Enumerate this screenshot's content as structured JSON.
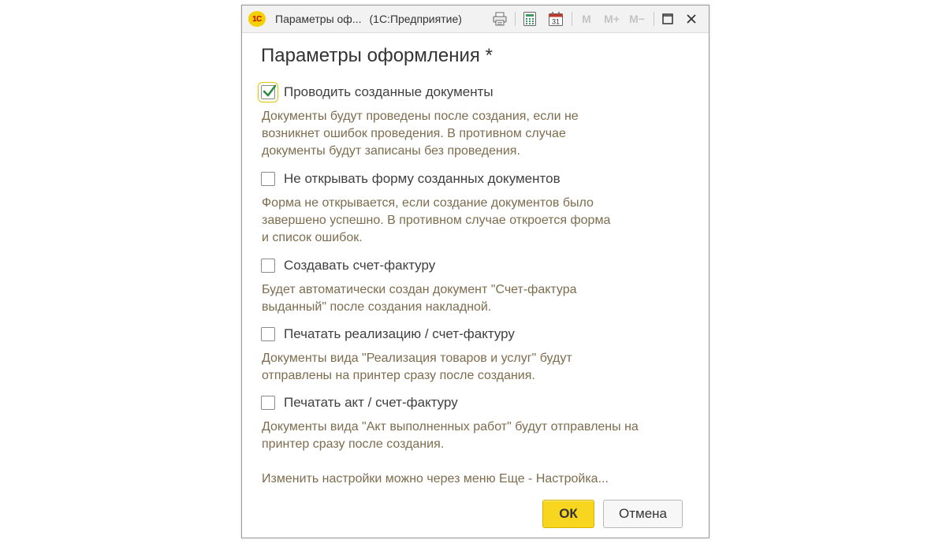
{
  "window": {
    "logo_text": "1С",
    "title": "Параметры оф...",
    "app_name": "(1С:Предприятие)",
    "toolbar": {
      "print_icon": "printer-icon",
      "calculator_icon": "calculator-icon",
      "calendar_icon": "calendar-icon",
      "calendar_day": "31",
      "m_label": "M",
      "m_plus_label": "M+",
      "m_minus_label": "M−"
    }
  },
  "form": {
    "title": "Параметры оформления *",
    "options": [
      {
        "label": "Проводить созданные документы",
        "checked": true,
        "hint": [
          "Документы будут проведены после создания, если не",
          "возникнет ошибок проведения. В противном случае",
          "документы будут записаны без проведения."
        ]
      },
      {
        "label": "Не открывать форму созданных документов",
        "checked": false,
        "hint": [
          "Форма не открывается, если создание документов было",
          "завершено успешно. В противном случае откроется форма",
          "и список ошибок."
        ]
      },
      {
        "label": "Создавать счет-фактуру",
        "checked": false,
        "hint": [
          "Будет автоматически создан документ \"Счет-фактура",
          "выданный\" после создания накладной."
        ]
      },
      {
        "label": "Печатать реализацию / счет-фактуру",
        "checked": false,
        "hint": [
          "Документы вида \"Реализация товаров и услуг\" будут",
          "отправлены на принтер сразу после создания."
        ]
      },
      {
        "label": "Печатать акт / счет-фактуру",
        "checked": false,
        "hint": [
          "Документы вида \"Акт выполненных работ\" будут отправлены на",
          "принтер сразу после создания."
        ]
      }
    ],
    "footer_note": "Изменить настройки можно через меню Еще - Настройка...",
    "ok_label": "ОК",
    "cancel_label": "Отмена"
  },
  "colors": {
    "accent_yellow": "#f8d51e",
    "checkmark_green": "#2e8b3e",
    "hint_text": "#7d6c4e"
  }
}
